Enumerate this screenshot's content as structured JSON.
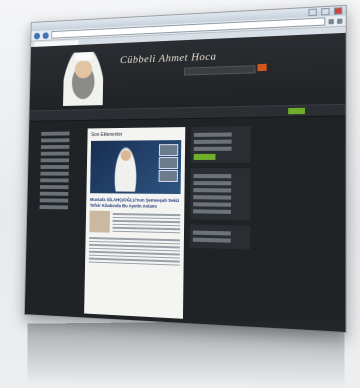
{
  "browser": {
    "window_title": "",
    "address": "",
    "tab_label": ""
  },
  "site": {
    "logo_text": "Cübbeli Ahmet Hoca",
    "menu_items": [
      "",
      "",
      "",
      "",
      "",
      ""
    ],
    "main": {
      "section_title": "Son Eklenenler",
      "article_title": "Mustafa SİLAHÇIOĞLU'nun Şemseşah Sekiz Tefsir Kitabında Bu Ayetin Anlamı"
    }
  },
  "colors": {
    "site_background": "#202326",
    "accent_orange": "#d2571f",
    "accent_green": "#6fae2b",
    "heading_red": "#d14b2c"
  }
}
